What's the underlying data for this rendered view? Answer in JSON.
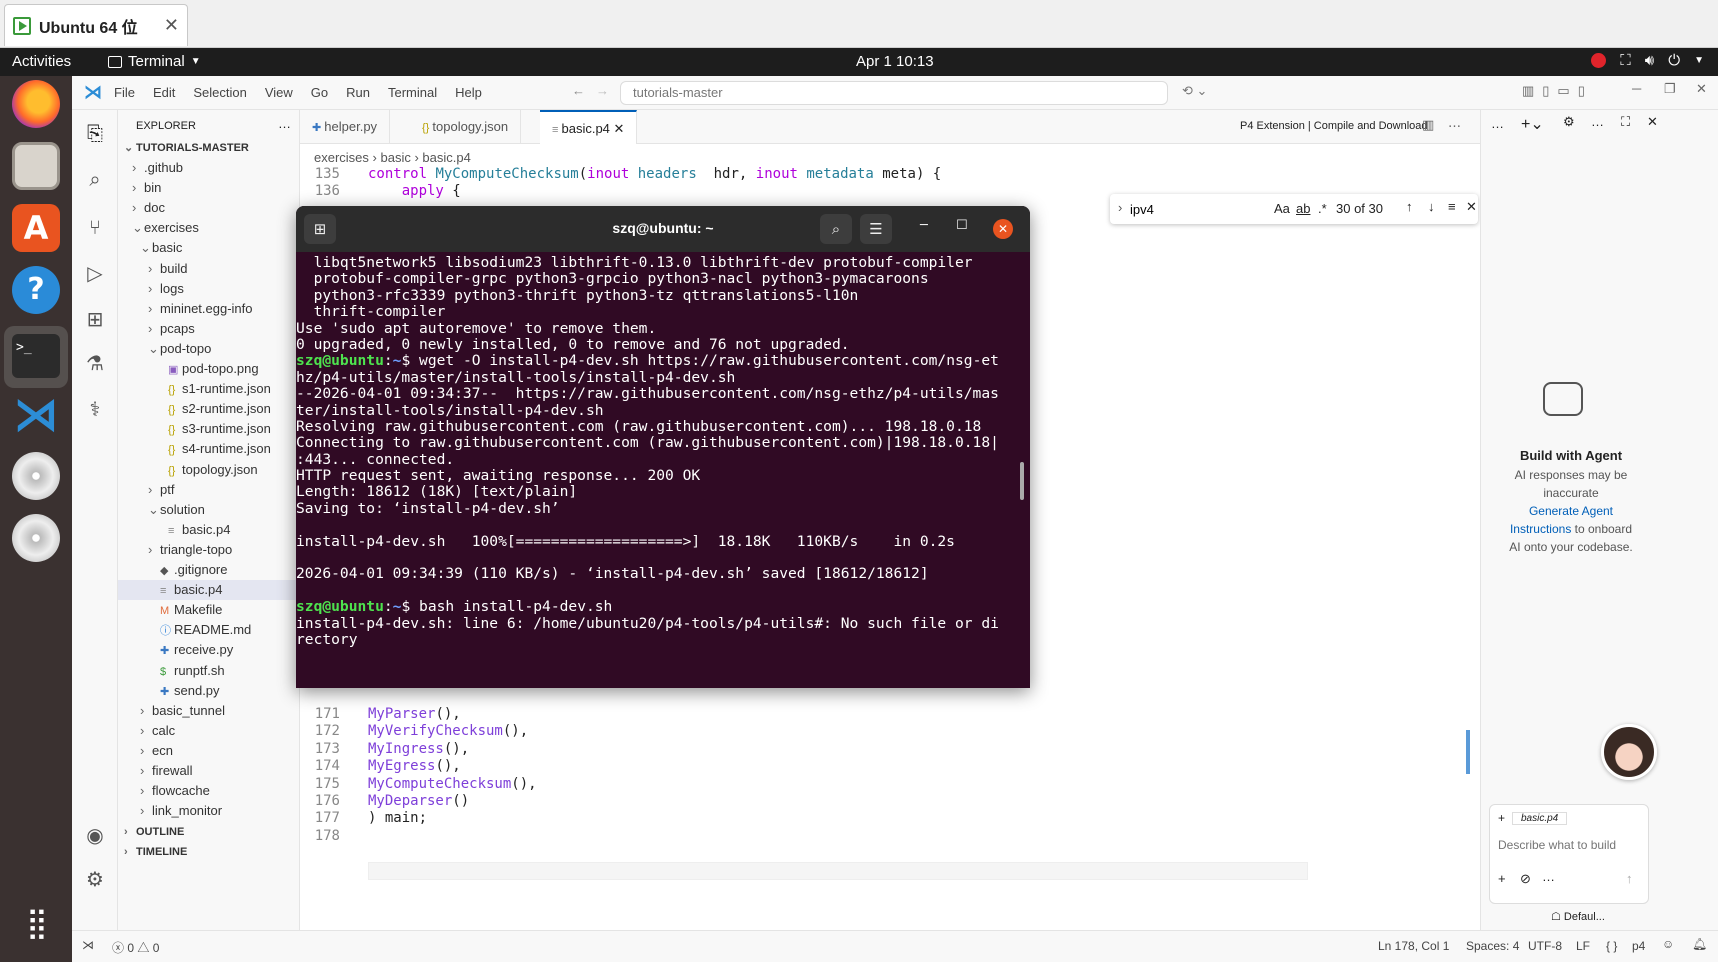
{
  "vm": {
    "tab_title": "Ubuntu 64 位"
  },
  "topbar": {
    "activities": "Activities",
    "app": "Terminal",
    "clock": "Apr 1  10:13"
  },
  "vscode": {
    "menu": [
      "File",
      "Edit",
      "Selection",
      "View",
      "Go",
      "Run",
      "Terminal",
      "Help"
    ],
    "command_center": "tutorials-master",
    "explorer": {
      "title": "EXPLORER",
      "root": "TUTORIALS-MASTER",
      "items": [
        {
          "label": ".github",
          "depth": 0,
          "kind": "folder"
        },
        {
          "label": "bin",
          "depth": 0,
          "kind": "folder"
        },
        {
          "label": "doc",
          "depth": 0,
          "kind": "folder"
        },
        {
          "label": "exercises",
          "depth": 0,
          "kind": "folder-open"
        },
        {
          "label": "basic",
          "depth": 1,
          "kind": "folder-open"
        },
        {
          "label": "build",
          "depth": 2,
          "kind": "folder"
        },
        {
          "label": "logs",
          "depth": 2,
          "kind": "folder"
        },
        {
          "label": "mininet.egg-info",
          "depth": 2,
          "kind": "folder"
        },
        {
          "label": "pcaps",
          "depth": 2,
          "kind": "folder"
        },
        {
          "label": "pod-topo",
          "depth": 2,
          "kind": "folder-open"
        },
        {
          "label": "pod-topo.png",
          "depth": 3,
          "kind": "image"
        },
        {
          "label": "s1-runtime.json",
          "depth": 3,
          "kind": "json"
        },
        {
          "label": "s2-runtime.json",
          "depth": 3,
          "kind": "json"
        },
        {
          "label": "s3-runtime.json",
          "depth": 3,
          "kind": "json"
        },
        {
          "label": "s4-runtime.json",
          "depth": 3,
          "kind": "json"
        },
        {
          "label": "topology.json",
          "depth": 3,
          "kind": "json"
        },
        {
          "label": "ptf",
          "depth": 2,
          "kind": "folder"
        },
        {
          "label": "solution",
          "depth": 2,
          "kind": "folder-open"
        },
        {
          "label": "basic.p4",
          "depth": 3,
          "kind": "file"
        },
        {
          "label": "triangle-topo",
          "depth": 2,
          "kind": "folder"
        },
        {
          "label": ".gitignore",
          "depth": 2,
          "kind": "git"
        },
        {
          "label": "basic.p4",
          "depth": 2,
          "kind": "file",
          "selected": true
        },
        {
          "label": "Makefile",
          "depth": 2,
          "kind": "make"
        },
        {
          "label": "README.md",
          "depth": 2,
          "kind": "info"
        },
        {
          "label": "receive.py",
          "depth": 2,
          "kind": "py"
        },
        {
          "label": "runptf.sh",
          "depth": 2,
          "kind": "sh"
        },
        {
          "label": "send.py",
          "depth": 2,
          "kind": "py"
        },
        {
          "label": "basic_tunnel",
          "depth": 1,
          "kind": "folder"
        },
        {
          "label": "calc",
          "depth": 1,
          "kind": "folder"
        },
        {
          "label": "ecn",
          "depth": 1,
          "kind": "folder"
        },
        {
          "label": "firewall",
          "depth": 1,
          "kind": "folder"
        },
        {
          "label": "flowcache",
          "depth": 1,
          "kind": "folder"
        },
        {
          "label": "link_monitor",
          "depth": 1,
          "kind": "folder"
        }
      ],
      "outline": "OUTLINE",
      "timeline": "TIMELINE"
    },
    "tabs": [
      {
        "label": "helper.py",
        "icon": "python-icon"
      },
      {
        "label": "topology.json",
        "icon": "json-icon"
      },
      {
        "label": "basic.p4",
        "icon": "file-icon",
        "active": true
      }
    ],
    "editor_title_action": "P4 Extension | Compile and Download",
    "breadcrumb": [
      "exercises",
      "basic",
      "basic.p4"
    ],
    "find": {
      "value": "ipv4",
      "count": "30 of 30",
      "aa": "Aa",
      "ab": "ab",
      "re": ".*"
    },
    "code_top": [
      {
        "n": "135",
        "segments": [
          [
            "kw",
            "control "
          ],
          [
            "ty",
            "MyComputeChecksum"
          ],
          [
            "id",
            "("
          ],
          [
            "kw",
            "inout "
          ],
          [
            "ty",
            "headers"
          ],
          [
            "id",
            "  hdr, "
          ],
          [
            "kw",
            "inout "
          ],
          [
            "ty",
            "metadata"
          ],
          [
            "id",
            " meta) {"
          ]
        ]
      },
      {
        "n": "136",
        "segments": [
          [
            "id",
            "    "
          ],
          [
            "kw",
            "apply"
          ],
          [
            "id",
            " {"
          ]
        ]
      }
    ],
    "code_bottom": [
      {
        "n": "171",
        "segments": [
          [
            "pu",
            "MyParser"
          ],
          [
            "id",
            "(),"
          ]
        ]
      },
      {
        "n": "172",
        "segments": [
          [
            "pu",
            "MyVerifyChecksum"
          ],
          [
            "id",
            "(),"
          ]
        ]
      },
      {
        "n": "173",
        "segments": [
          [
            "pu",
            "MyIngress"
          ],
          [
            "id",
            "(),"
          ]
        ]
      },
      {
        "n": "174",
        "segments": [
          [
            "pu",
            "MyEgress"
          ],
          [
            "id",
            "(),"
          ]
        ]
      },
      {
        "n": "175",
        "segments": [
          [
            "pu",
            "MyComputeChecksum"
          ],
          [
            "id",
            "(),"
          ]
        ]
      },
      {
        "n": "176",
        "segments": [
          [
            "pu",
            "MyDeparser"
          ],
          [
            "id",
            "()"
          ]
        ]
      },
      {
        "n": "177",
        "segments": [
          [
            "id",
            ") main;"
          ]
        ]
      },
      {
        "n": "178",
        "segments": []
      }
    ],
    "chat": {
      "title": "Build with Agent",
      "line1": "AI responses may be",
      "line2": "inaccurate",
      "link1": "Generate Agent",
      "link2": "Instructions",
      "tail": " to onboard",
      "line4": "AI onto your codebase.",
      "context_file": "basic.p4",
      "placeholder": "Describe what to build",
      "mode": "Defaul..."
    },
    "status": {
      "errors": "0",
      "warnings": "0",
      "position": "Ln 178, Col 1",
      "spaces": "Spaces: 4",
      "encoding": "UTF-8",
      "eol": "LF",
      "lang_icon": "{ }",
      "lang": "p4"
    }
  },
  "terminal": {
    "title": "szq@ubuntu: ~",
    "lines": [
      [
        [
          "t",
          "  libqt5network5 libsodium23 libthrift-0.13.0 libthrift-dev protobuf-compiler"
        ]
      ],
      [
        [
          "t",
          "  protobuf-compiler-grpc python3-grpcio python3-nacl python3-pymacaroons"
        ]
      ],
      [
        [
          "t",
          "  python3-rfc3339 python3-thrift python3-tz qttranslations5-l10n"
        ]
      ],
      [
        [
          "t",
          "  thrift-compiler"
        ]
      ],
      [
        [
          "t",
          "Use 'sudo apt autoremove' to remove them."
        ]
      ],
      [
        [
          "t",
          "0 upgraded, 0 newly installed, 0 to remove and 76 not upgraded."
        ]
      ],
      [
        [
          "g",
          "szq@ubuntu"
        ],
        [
          "t",
          ":"
        ],
        [
          "b",
          "~"
        ],
        [
          "t",
          "$ wget -O install-p4-dev.sh https://raw.githubusercontent.com/nsg-et"
        ]
      ],
      [
        [
          "t",
          "hz/p4-utils/master/install-tools/install-p4-dev.sh"
        ]
      ],
      [
        [
          "t",
          "--2026-04-01 09:34:37--  https://raw.githubusercontent.com/nsg-ethz/p4-utils/mas"
        ]
      ],
      [
        [
          "t",
          "ter/install-tools/install-p4-dev.sh"
        ]
      ],
      [
        [
          "t",
          "Resolving raw.githubusercontent.com (raw.githubusercontent.com)... 198.18.0.18"
        ]
      ],
      [
        [
          "t",
          "Connecting to raw.githubusercontent.com (raw.githubusercontent.com)|198.18.0.18|"
        ]
      ],
      [
        [
          "t",
          ":443... connected."
        ]
      ],
      [
        [
          "t",
          "HTTP request sent, awaiting response... 200 OK"
        ]
      ],
      [
        [
          "t",
          "Length: 18612 (18K) [text/plain]"
        ]
      ],
      [
        [
          "t",
          "Saving to: ‘install-p4-dev.sh’"
        ]
      ],
      [
        [
          "t",
          ""
        ]
      ],
      [
        [
          "t",
          "install-p4-dev.sh   100%[===================>]  18.18K   110KB/s    in 0.2s"
        ]
      ],
      [
        [
          "t",
          ""
        ]
      ],
      [
        [
          "t",
          "2026-04-01 09:34:39 (110 KB/s) - ‘install-p4-dev.sh’ saved [18612/18612]"
        ]
      ],
      [
        [
          "t",
          ""
        ]
      ],
      [
        [
          "g",
          "szq@ubuntu"
        ],
        [
          "t",
          ":"
        ],
        [
          "b",
          "~"
        ],
        [
          "t",
          "$ bash install-p4-dev.sh"
        ]
      ],
      [
        [
          "t",
          "install-p4-dev.sh: line 6: /home/ubuntu20/p4-tools/p4-utils#: No such file or di"
        ]
      ],
      [
        [
          "t",
          "rectory"
        ]
      ]
    ]
  }
}
